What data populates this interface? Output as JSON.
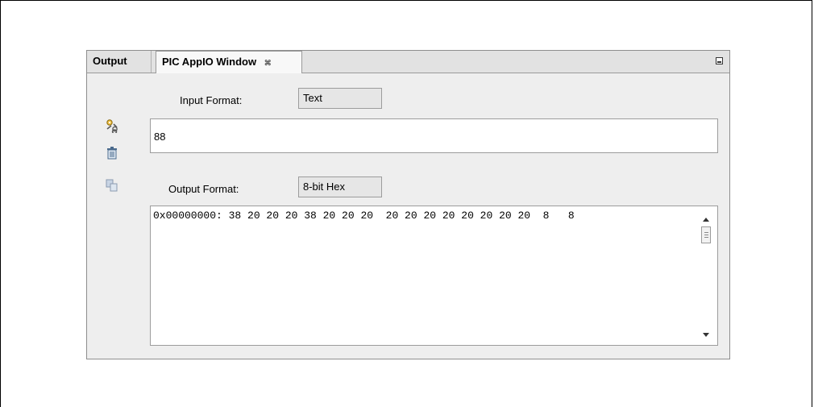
{
  "tabs": {
    "output_label": "Output",
    "appio_label": "PIC AppIO Window",
    "close_glyph": "⌘"
  },
  "toolbar": {
    "icons": [
      "wrench-gear-icon",
      "trash-icon",
      "copy-icon"
    ]
  },
  "input": {
    "format_label": "Input Format:",
    "format_value": "Text",
    "value": "88"
  },
  "output": {
    "format_label": "Output Format:",
    "format_value": "8-bit Hex",
    "line": "0x00000000: 38 20 20 20 38 20 20 20  20 20 20 20 20 20 20 20  8   8"
  },
  "colors": {
    "panel_bg": "#eeeeee",
    "tab_active_bg": "#f8f8f8",
    "field_bg": "#ffffff"
  }
}
